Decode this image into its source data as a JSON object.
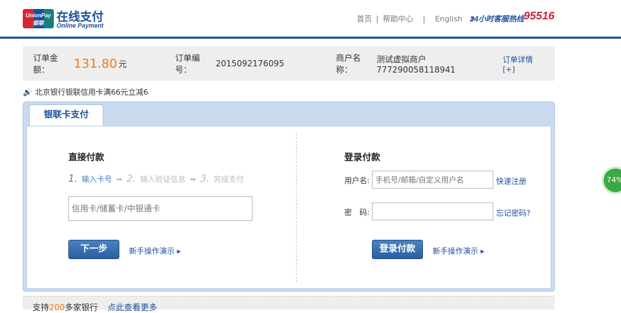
{
  "header": {
    "logo_text": "UnionPay 银联",
    "title_cn": "在线支付",
    "title_en": "Online Payment",
    "nav": [
      "首页",
      "帮助中心",
      "English"
    ],
    "hotline_label": "24小时客服热线",
    "hotline_number": "95516"
  },
  "order": {
    "amount_label": "订单金额：",
    "amount": "131.80",
    "currency": "元",
    "number_label": "订单编号：",
    "number": "2015092176095",
    "merchant_label": "商户名称：",
    "merchant": "测试虚拟商户777290058118941",
    "details_link": "订单详情[+]"
  },
  "notice": "北京银行银联信用卡满66元立减6",
  "tab": "银联卡支付",
  "direct": {
    "title": "直接付款",
    "steps": [
      "1.",
      "输入卡号",
      "2.",
      "输入验证信息",
      "3.",
      "完成支付"
    ],
    "card_placeholder": "信用卡/储蓄卡/中银通卡",
    "next_button": "下一步",
    "demo_link": "新手操作演示"
  },
  "login": {
    "title": "登录付款",
    "username_label": "用户名:",
    "username_placeholder": "手机号/邮箱/自定义用户名",
    "register_link": "快速注册",
    "password_label": "密　码:",
    "forgot_link": "忘记密码?",
    "login_button": "登录付款",
    "demo_link": "新手操作演示"
  },
  "footer": {
    "prefix": "支持",
    "count": "200",
    "suffix": "多家银行",
    "more_link": "点此查看更多"
  },
  "badge": "74%"
}
